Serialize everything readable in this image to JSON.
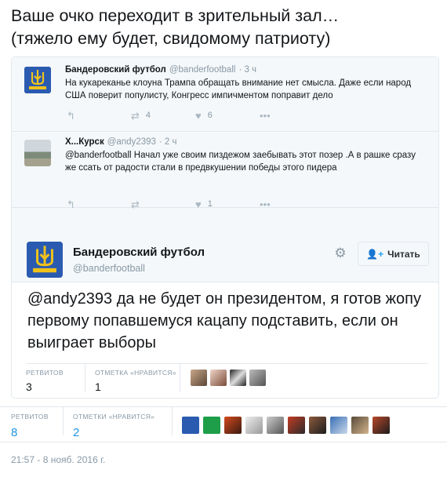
{
  "headline": {
    "line1": "Ваше очко переходит в зрительный зал…",
    "line2": "(тяжело ему будет, свидомому патриоту)"
  },
  "reply1": {
    "name": "Бандеровский футбол",
    "handle": "@banderfootball",
    "time": "· 3 ч",
    "text": "На кукареканье клоуна Трампа обращать внимание нет смысла. Даже если народ США поверит популисту, Конгресс импичментом поправит дело",
    "retweets": "4",
    "likes": "6",
    "avatar_icon": "trident-emblem-icon"
  },
  "reply2": {
    "name": "Х...Курск",
    "handle": "@andy2393",
    "time": "· 2 ч",
    "text": "@banderfootball Начал уже своим пиздежом заебывать этот позер .А в рашке сразу же ссать от радости стали в предвкушении победы этого пидера",
    "retweets": "",
    "likes": "1",
    "avatar_icon": "city-photo"
  },
  "main_tweet": {
    "name": "Бандеровский футбол",
    "handle": "@banderfootball",
    "follow_label": "Читать",
    "mention": "@andy2393",
    "text": " да не будет он президентом, я готов жопу первому попавшемуся кацапу подставить, если он выиграет выборы",
    "retweets_label": "РЕТВИТОВ",
    "retweets": "3",
    "likes_label": "ОТМЕТКА «НРАВИТСЯ»",
    "likes": "1"
  },
  "outer": {
    "retweets_label": "РЕТВИТОВ",
    "retweets": "8",
    "likes_label": "ОТМЕТКИ «НРАВИТСЯ»",
    "likes": "2",
    "timestamp": "21:57 - 8 нояб. 2016 г."
  },
  "colors": {
    "accent": "#1b95e0",
    "muted": "#8899a6",
    "border": "#e1e8ed",
    "emblem_blue": "#2a5bb0",
    "emblem_gold": "#f2c21a"
  }
}
